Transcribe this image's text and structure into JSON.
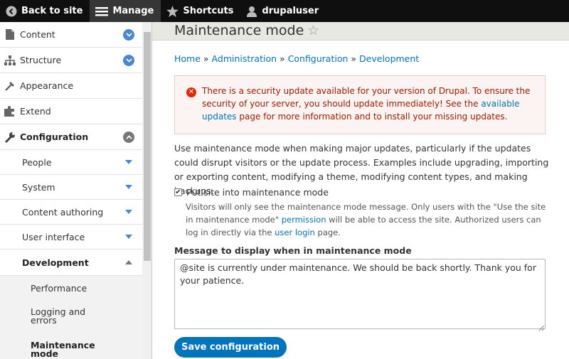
{
  "toolbar": {
    "back_label": "Back to site",
    "manage_label": "Manage",
    "shortcuts_label": "Shortcuts",
    "user_label": "drupaluser"
  },
  "sidebar": {
    "items": [
      {
        "label": "Content"
      },
      {
        "label": "Structure"
      },
      {
        "label": "Appearance"
      },
      {
        "label": "Extend"
      },
      {
        "label": "Configuration"
      },
      {
        "label": "People"
      },
      {
        "label": "System"
      },
      {
        "label": "Content authoring"
      },
      {
        "label": "User interface"
      },
      {
        "label": "Development"
      },
      {
        "label": "Performance"
      },
      {
        "label": "Logging and errors"
      },
      {
        "label": "Maintenance mode"
      }
    ]
  },
  "main": {
    "title": "Maintenance mode",
    "breadcrumb": [
      "Home",
      "Administration",
      "Configuration",
      "Development"
    ],
    "breadcrumb_sep": "»",
    "error": {
      "text1": "There is a security update available for your version of Drupal. To ensure the security of your server, you should update immediately! See the ",
      "link": "available updates",
      "text2": " page for more information and to install your missing updates."
    },
    "description": "Use maintenance mode when making major updates, particularly if the updates could disrupt visitors or the update process. Examples include upgrading, importing or exporting content, modifying a theme, modifying content types, and making backups.",
    "checkbox_label": "Put site into maintenance mode",
    "checkbox_checked": true,
    "checkbox_desc": {
      "text1": "Visitors will only see the maintenance mode message. Only users with the \"Use the site in maintenance mode\" ",
      "link1": "permission",
      "text2": " will be able to access the site. Authorized users can log in directly via the ",
      "link2": "user login",
      "text3": " page."
    },
    "textarea_label": "Message to display when in maintenance mode",
    "textarea_value": "@site is currently under maintenance. We should be back shortly. Thank you for your patience.",
    "save_label": "Save configuration"
  },
  "colors": {
    "link": "#0074bd",
    "error_text": "#a51b00",
    "error_bg": "#fcf4f2",
    "button": "#0074bd",
    "toolbar_bg": "#0f0f0f",
    "chevron_blue": "#4a86d4"
  },
  "icons": [
    "chevron-left-icon",
    "hamburger-icon",
    "star-icon",
    "user-icon",
    "content-icon",
    "structure-icon",
    "appearance-icon",
    "extend-icon",
    "wrench-icon",
    "error-icon",
    "bookmark-star-icon"
  ]
}
